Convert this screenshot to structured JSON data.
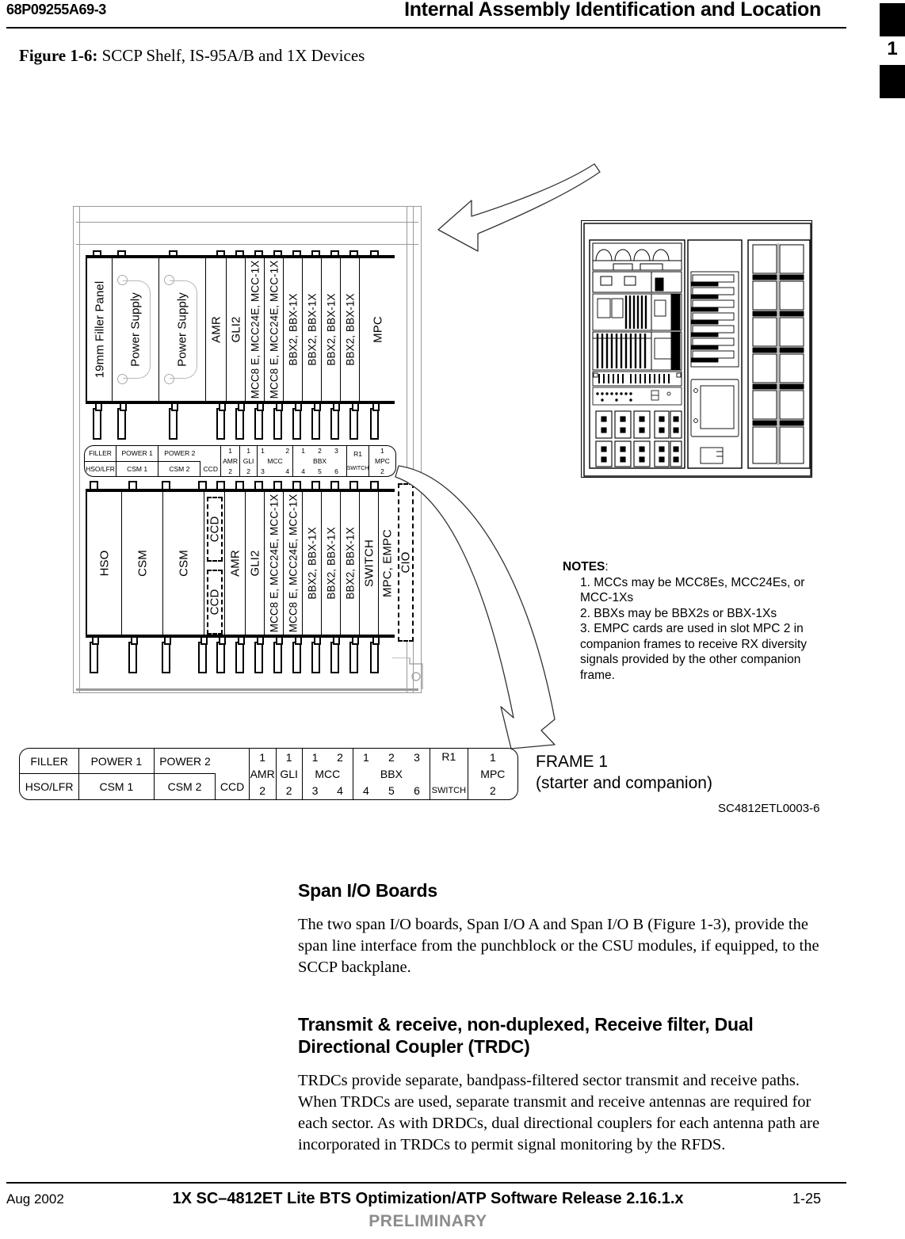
{
  "header": {
    "doc_number": "68P09255A69-3",
    "title": "Internal Assembly Identification and Location",
    "chapter_tab": "1"
  },
  "figure": {
    "label": "Figure 1-6:",
    "caption": "SCCP Shelf, IS-95A/B and 1X Devices",
    "drawing_number": "SC4812ETL0003-6",
    "frame_caption_line1": "FRAME 1",
    "frame_caption_line2": "(starter and companion)"
  },
  "top_shelf": {
    "cards": [
      {
        "label": "19mm Filler Panel",
        "type": "filler"
      },
      {
        "label": "Power Supply",
        "type": "power"
      },
      {
        "label": "Power Supply",
        "type": "power"
      },
      {
        "label": "AMR",
        "type": "card"
      },
      {
        "label": "GLI2",
        "type": "card"
      },
      {
        "label": "MCC8 E, MCC24E, MCC-1X",
        "type": "card"
      },
      {
        "label": "MCC8 E, MCC24E, MCC-1X",
        "type": "card"
      },
      {
        "label": "BBX2, BBX-1X",
        "type": "card"
      },
      {
        "label": "BBX2, BBX-1X",
        "type": "card"
      },
      {
        "label": "BBX2, BBX-1X",
        "type": "card"
      },
      {
        "label": "BBX2, BBX-1X",
        "type": "card"
      },
      {
        "label": "MPC",
        "type": "card"
      }
    ]
  },
  "bottom_shelf": {
    "cards": [
      {
        "label": "HSO",
        "type": "card"
      },
      {
        "label": "CSM",
        "type": "card"
      },
      {
        "label": "CSM",
        "type": "card"
      },
      {
        "label": "CCD",
        "type": "dashed-upper"
      },
      {
        "label": "CCD",
        "type": "dashed-lower"
      },
      {
        "label": "AMR",
        "type": "card"
      },
      {
        "label": "GLI2",
        "type": "card"
      },
      {
        "label": "MCC8 E, MCC24E, MCC-1X",
        "type": "card"
      },
      {
        "label": "MCC8 E, MCC24E, MCC-1X",
        "type": "card"
      },
      {
        "label": "BBX2, BBX-1X",
        "type": "card"
      },
      {
        "label": "BBX2, BBX-1X",
        "type": "card"
      },
      {
        "label": "BBX2, BBX-1X",
        "type": "card"
      },
      {
        "label": "SWITCH",
        "type": "card"
      },
      {
        "label": "MPC, EMPC",
        "type": "card"
      },
      {
        "label": "CIO",
        "type": "dashed"
      }
    ]
  },
  "slot_legend": {
    "filler": "FILLER",
    "hso_lfr": "HSO/LFR",
    "power1": "POWER 1",
    "power2": "POWER 2",
    "csm1": "CSM 1",
    "csm2": "CSM 2",
    "ccd": "CCD",
    "amr": {
      "name": "AMR",
      "top": "1",
      "bottom": "2"
    },
    "gli": {
      "name": "GLI",
      "top": "1",
      "bottom": "2"
    },
    "mcc": {
      "name": "MCC",
      "top": [
        "1",
        "2"
      ],
      "bottom": [
        "3",
        "4"
      ]
    },
    "bbx": {
      "name": "BBX",
      "top": [
        "1",
        "2",
        "3"
      ],
      "bottom": [
        "4",
        "5",
        "6"
      ]
    },
    "switch": {
      "name": "R1",
      "sub": "SWITCH"
    },
    "mpc": {
      "name": "MPC",
      "top": "1",
      "bottom": "2"
    }
  },
  "notes": {
    "title": "NOTES",
    "colon": ":",
    "items": [
      "1. MCCs may be MCC8Es, MCC24Es, or MCC-1Xs",
      "2. BBXs may be BBX2s or BBX-1Xs",
      "3. EMPC cards are used in slot MPC 2 in companion frames to receive RX diversity signals provided by the other companion frame."
    ]
  },
  "body": {
    "section1_heading": "Span I/O Boards",
    "section1_paragraph": "The two span I/O boards, Span I/O A and Span I/O B (Figure 1-3), provide the span line interface from the punchblock or the CSU modules, if equipped, to the SCCP backplane.",
    "section2_heading": "Transmit & receive, non-duplexed, Receive filter, Dual Directional Coupler (TRDC)",
    "section2_paragraph": "TRDCs provide separate, bandpass-filtered sector transmit and receive paths. When TRDCs are used, separate transmit and receive antennas are required for each sector. As with DRDCs, dual directional couplers for each antenna path are incorporated in TRDCs to permit signal monitoring by the RFDS."
  },
  "footer": {
    "date": "Aug 2002",
    "title": "1X SC–4812ET Lite BTS Optimization/ATP Software Release 2.16.1.x",
    "page": "1-25",
    "status": "PRELIMINARY"
  },
  "colors": {
    "ink": "#000000",
    "cabinet_gray": "#9a9a9a",
    "preliminary_gray": "#8c8c8c"
  }
}
